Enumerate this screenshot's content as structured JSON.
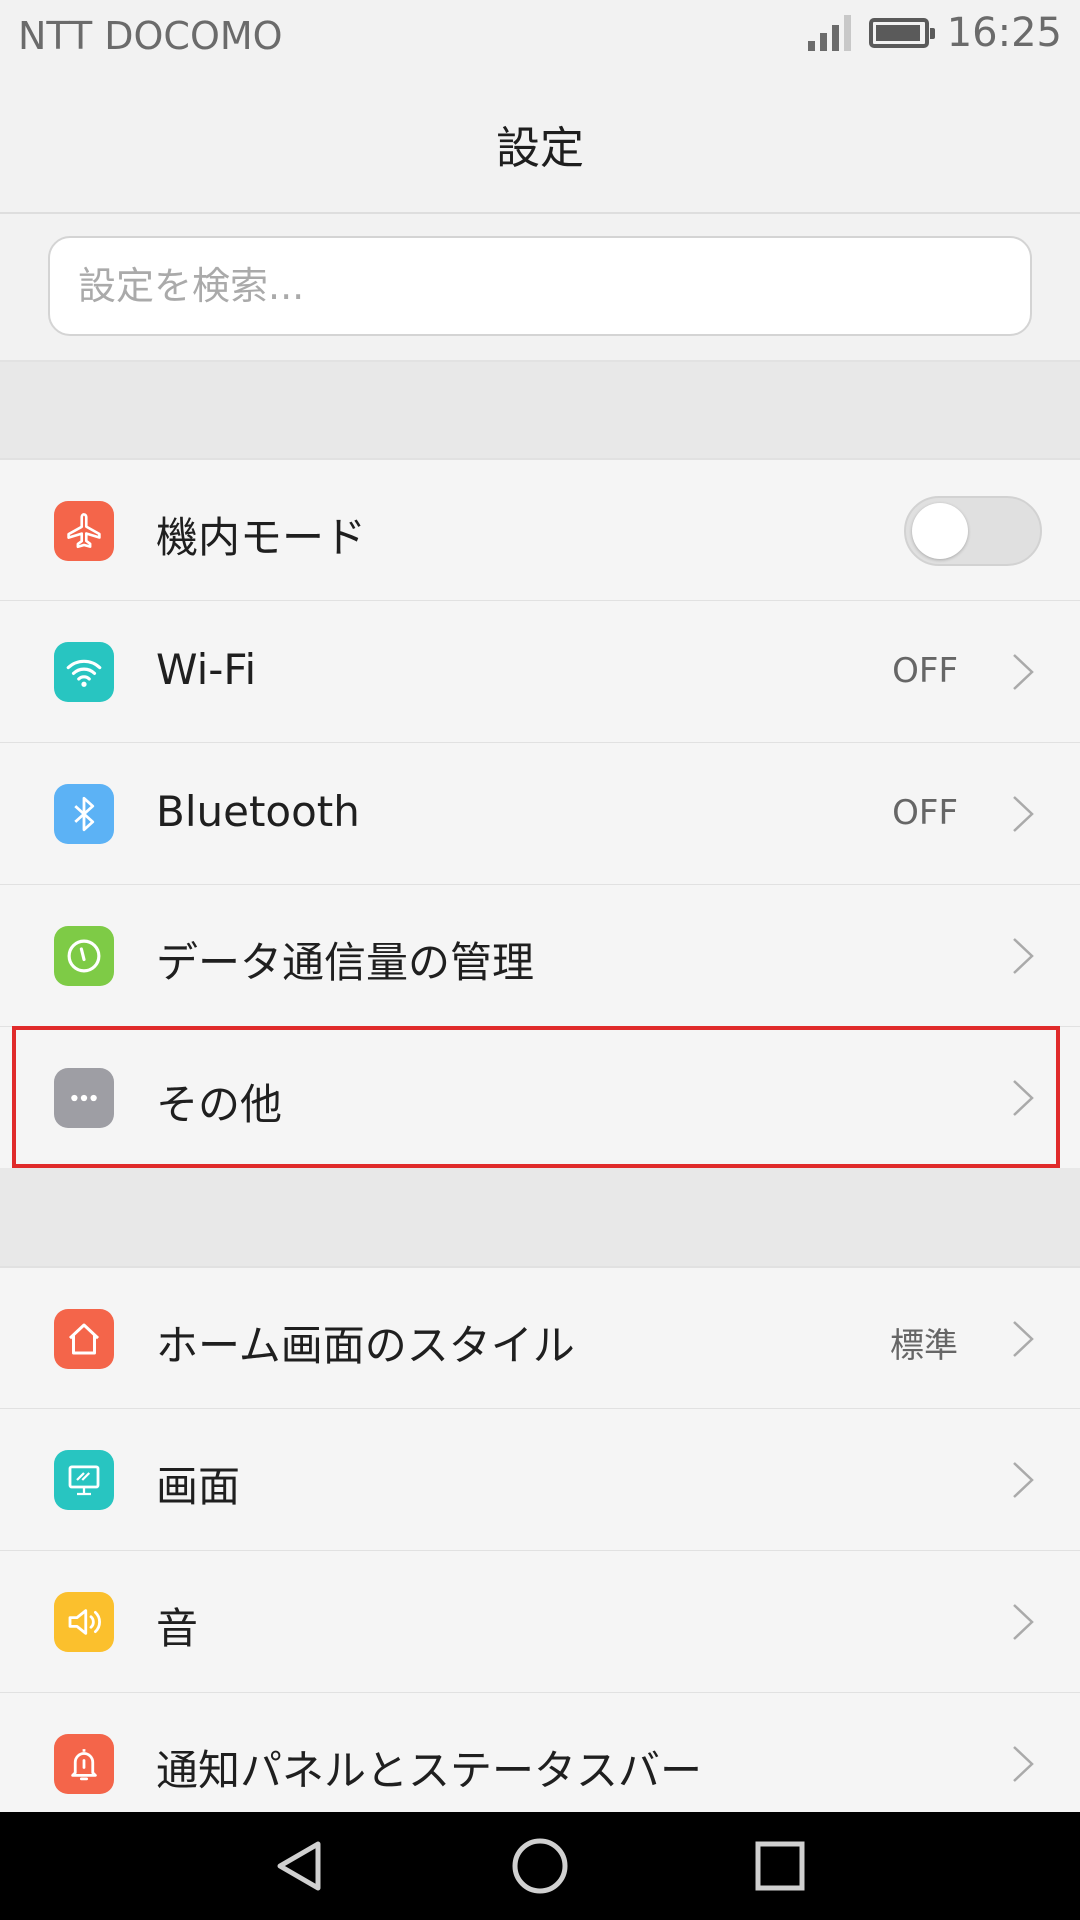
{
  "status_bar": {
    "carrier": "NTT DOCOMO",
    "time": "16:25",
    "signal_bars_filled": 3,
    "signal_bars_total": 4,
    "battery_level": 0.9
  },
  "header": {
    "title": "設定"
  },
  "search": {
    "placeholder": "設定を検索..."
  },
  "group1": {
    "airplane": {
      "label": "機内モード",
      "icon": "airplane-icon",
      "color": "#f4654a",
      "toggle_on": false
    },
    "wifi": {
      "label": "Wi-Fi",
      "value": "OFF",
      "icon": "wifi-icon",
      "color": "#28c5c1"
    },
    "bluetooth": {
      "label": "Bluetooth",
      "value": "OFF",
      "icon": "bluetooth-icon",
      "color": "#5cb2f5"
    },
    "data_usage": {
      "label": "データ通信量の管理",
      "icon": "data-usage-icon",
      "color": "#7ecb46"
    },
    "other": {
      "label": "その他",
      "icon": "more-icon",
      "color": "#9e9ea4"
    }
  },
  "group2": {
    "home_style": {
      "label": "ホーム画面のスタイル",
      "value": "標準",
      "icon": "home-icon",
      "color": "#f4654a"
    },
    "display": {
      "label": "画面",
      "icon": "display-icon",
      "color": "#28c5c1"
    },
    "sound": {
      "label": "音",
      "icon": "sound-icon",
      "color": "#fbc02d"
    },
    "notification": {
      "label": "通知パネルとステータスバー",
      "icon": "bell-icon",
      "color": "#f4654a"
    }
  },
  "highlight_color": "#e02a2a",
  "nav_bar": {
    "back": "back-icon",
    "home": "home-circle-icon",
    "recents": "recents-icon"
  }
}
